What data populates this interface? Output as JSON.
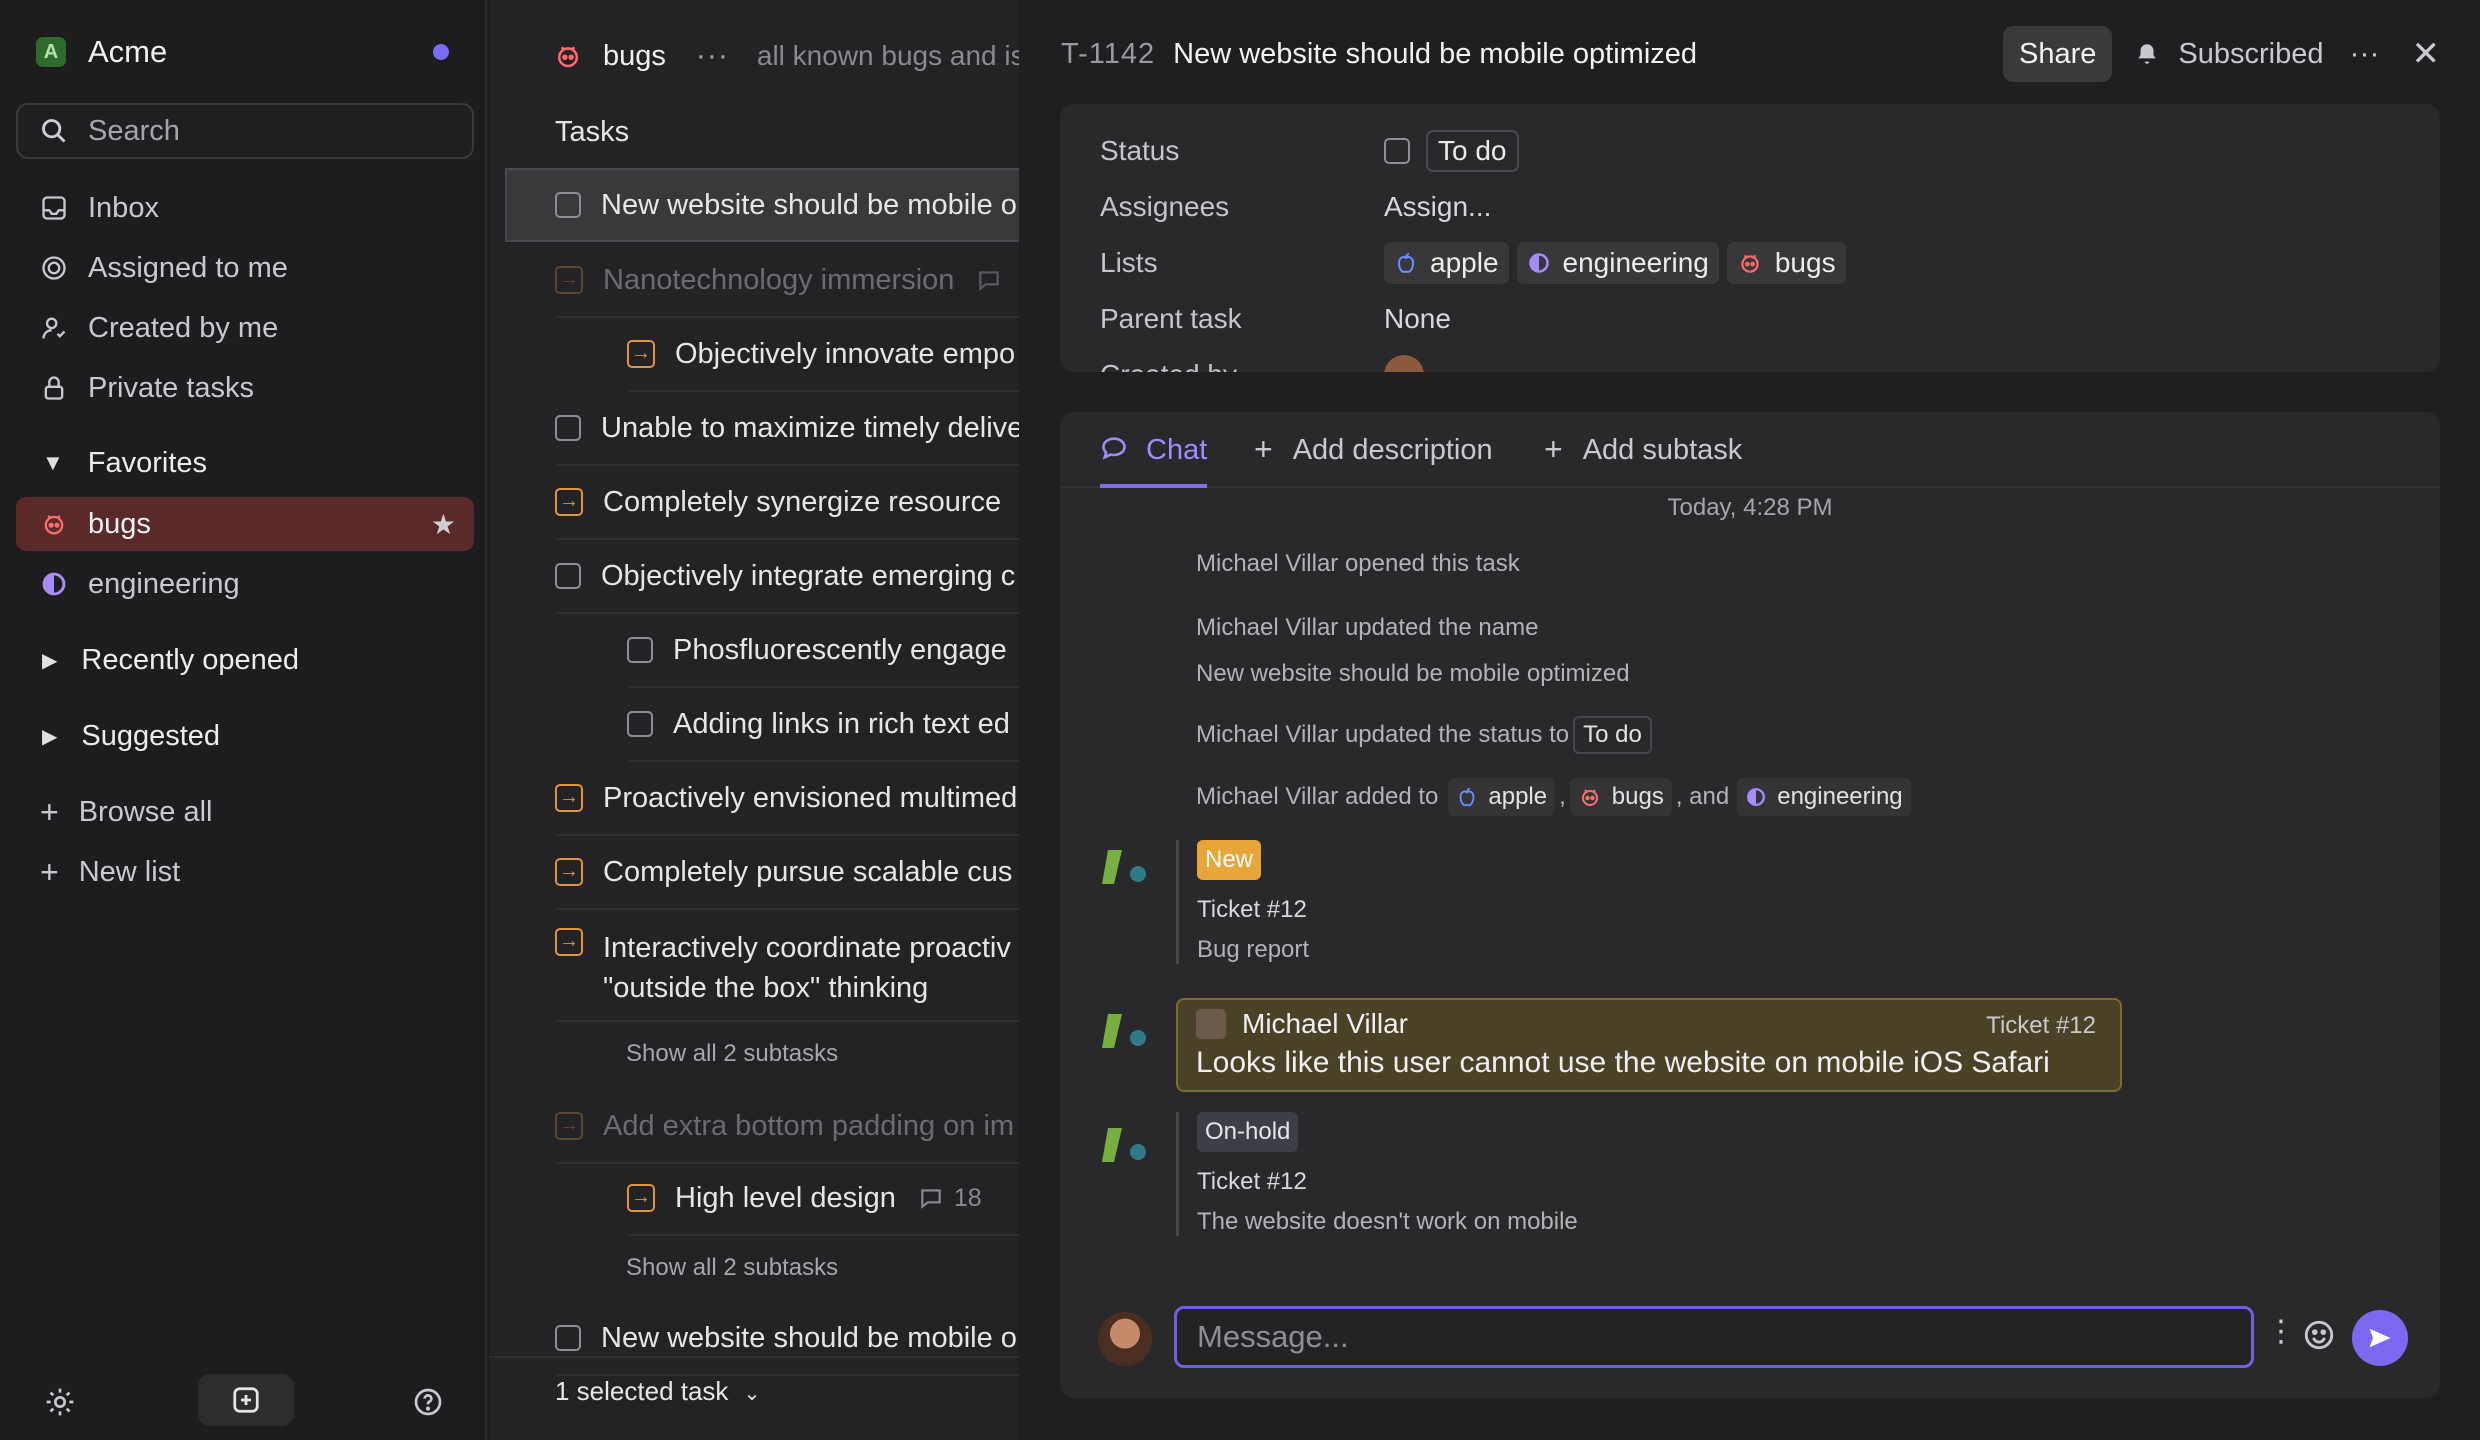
{
  "workspace": {
    "name": "Acme",
    "initial": "A"
  },
  "search": {
    "placeholder": "Search"
  },
  "nav": [
    {
      "label": "Inbox",
      "icon": "inbox-icon"
    },
    {
      "label": "Assigned to me",
      "icon": "target-icon"
    },
    {
      "label": "Created by me",
      "icon": "user-icon"
    },
    {
      "label": "Private tasks",
      "icon": "lock-icon"
    }
  ],
  "favorites": {
    "label": "Favorites",
    "items": [
      {
        "label": "bugs",
        "icon": "bug-icon"
      },
      {
        "label": "engineering",
        "icon": "half-circle-icon"
      }
    ]
  },
  "sections": {
    "recent": "Recently opened",
    "suggested": "Suggested"
  },
  "actions": {
    "browse": "Browse all",
    "new_list": "New list"
  },
  "list": {
    "title": "bugs",
    "more": "···",
    "description": "all known bugs and is",
    "tasks_label": "Tasks",
    "tasks": [
      "New website should be mobile o",
      "Nanotechnology immersion",
      "Objectively innovate empo",
      "Unable to maximize timely delive",
      "Completely synergize resource",
      "Objectively integrate emerging c",
      "Phosfluorescently engage",
      "Adding links in rich text ed",
      "Proactively envisioned multimed",
      "Completely pursue scalable cus",
      "Interactively coordinate proactiv \"outside the box\" thinking",
      "Add extra bottom padding on im",
      "High level design",
      "New website should be mobile o"
    ],
    "show_all": "Show all 2 subtasks",
    "comment_count": "18",
    "selected": "1 selected task"
  },
  "detail": {
    "id": "T-1142",
    "title": "New website should be mobile optimized",
    "share": "Share",
    "subscribed": "Subscribed",
    "props": {
      "status_label": "Status",
      "status_value": "To do",
      "assignees_label": "Assignees",
      "assignees_value": "Assign...",
      "lists_label": "Lists",
      "lists": [
        "apple",
        "engineering",
        "bugs"
      ],
      "parent_label": "Parent task",
      "parent_value": "None",
      "created_label": "Created by"
    },
    "tabs": {
      "chat": "Chat",
      "add_description": "Add description",
      "add_subtask": "Add subtask"
    },
    "day": "Today, 4:28 PM",
    "events": {
      "opened": "Michael Villar opened this task",
      "updated_name": "Michael Villar updated the name",
      "new_name": "New website should be mobile optimized",
      "updated_status": "Michael Villar updated the status to",
      "status_chip": "To do",
      "added_to": "Michael Villar added to",
      "comma": ",",
      "and": ", and",
      "chips": [
        "apple",
        "bugs",
        "engineering"
      ]
    },
    "messages": [
      {
        "badge": "New",
        "ticket": "Ticket #12",
        "text": "Bug report"
      },
      {
        "badge": "On-hold",
        "ticket": "Ticket #12",
        "text": "The website doesn't work on mobile"
      }
    ],
    "quote": {
      "author": "Michael Villar",
      "ref": "Ticket #12",
      "body": "Looks like this user cannot use the website on mobile iOS Safari"
    },
    "composer": {
      "placeholder": "Message..."
    }
  },
  "colors": {
    "accent": "#7b6cf6",
    "bugs": "#e35a5a",
    "engineering": "#a78bfa",
    "apple": "#6b8cff",
    "warning": "#e0943c"
  }
}
